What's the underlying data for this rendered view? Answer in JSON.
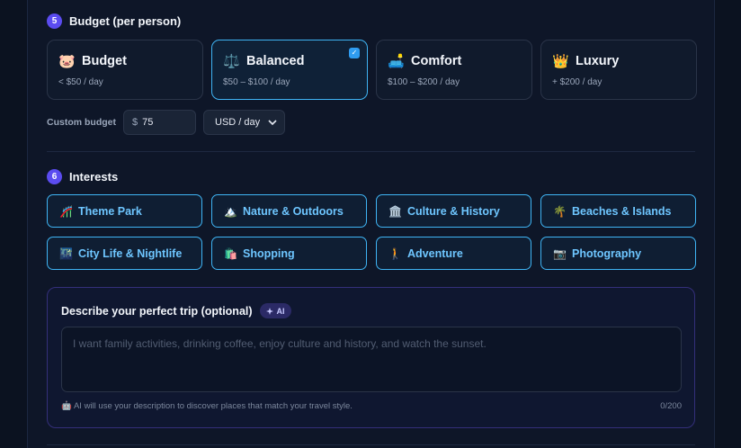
{
  "budget_section": {
    "step": "5",
    "title": "Budget (per person)",
    "options": [
      {
        "icon": "🐷",
        "icon_name": "piggy-bank-icon",
        "label": "Budget",
        "range": "< $50 / day",
        "selected": false
      },
      {
        "icon": "⚖️",
        "icon_name": "balance-scale-icon",
        "label": "Balanced",
        "range": "$50 – $100 / day",
        "selected": true
      },
      {
        "icon": "🛋️",
        "icon_name": "armchair-icon",
        "label": "Comfort",
        "range": "$100 – $200 / day",
        "selected": false
      },
      {
        "icon": "👑",
        "icon_name": "crown-icon",
        "label": "Luxury",
        "range": "+ $200 / day",
        "selected": false
      }
    ],
    "custom_label": "Custom budget",
    "currency_symbol": "$",
    "custom_value": "75",
    "unit_selected": "USD / day"
  },
  "interests_section": {
    "step": "6",
    "title": "Interests",
    "items": [
      {
        "icon": "🎢",
        "icon_name": "roller-coaster-icon",
        "label": "Theme Park"
      },
      {
        "icon": "🏔️",
        "icon_name": "mountain-icon",
        "label": "Nature & Outdoors"
      },
      {
        "icon": "🏛️",
        "icon_name": "classical-building-icon",
        "label": "Culture & History"
      },
      {
        "icon": "🌴",
        "icon_name": "palm-tree-icon",
        "label": "Beaches & Islands"
      },
      {
        "icon": "🌃",
        "icon_name": "city-night-icon",
        "label": "City Life & Nightlife"
      },
      {
        "icon": "🛍️",
        "icon_name": "shopping-bags-icon",
        "label": "Shopping"
      },
      {
        "icon": "🚶",
        "icon_name": "hiker-icon",
        "label": "Adventure"
      },
      {
        "icon": "📷",
        "icon_name": "camera-icon",
        "label": "Photography"
      }
    ]
  },
  "trip_description": {
    "title": "Describe your perfect trip (optional)",
    "ai_badge": "AI",
    "placeholder": "I want family activities, drinking coffee, enjoy culture and history, and watch the sunset.",
    "hint_icon": "🤖",
    "hint": "AI will use your description to discover places that match your travel style.",
    "counter": "0/200"
  },
  "colors": {
    "accent": "#3fb4f4",
    "step_badge": "#5b4cf0",
    "background": "#0b1220"
  }
}
